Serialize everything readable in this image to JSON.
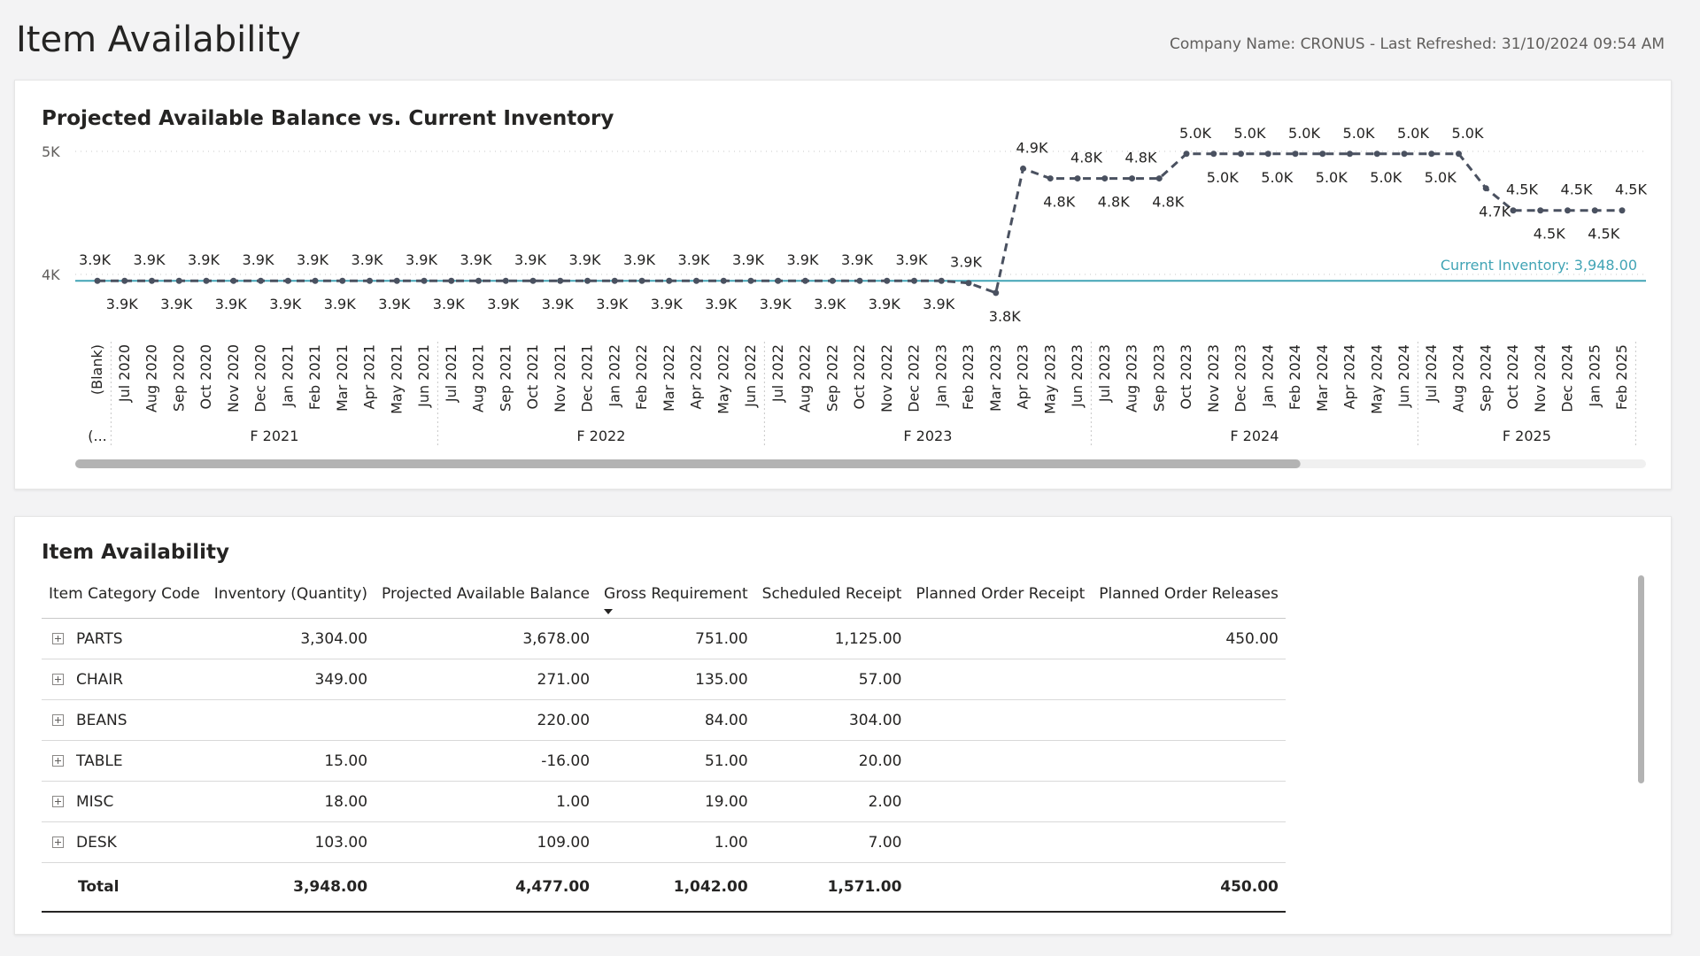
{
  "page": {
    "title": "Item Availability",
    "header_info": "Company Name: CRONUS - Last Refreshed: 31/10/2024 09:54 AM"
  },
  "chart_data": {
    "type": "line",
    "title": "Projected Available Balance vs. Current Inventory",
    "y_ticks": [
      "4K",
      "5K"
    ],
    "ylim": [
      3700,
      5050
    ],
    "categories": [
      "(Blank)",
      "Jul 2020",
      "Aug 2020",
      "Sep 2020",
      "Oct 2020",
      "Nov 2020",
      "Dec 2020",
      "Jan 2021",
      "Feb 2021",
      "Mar 2021",
      "Apr 2021",
      "May 2021",
      "Jun 2021",
      "Jul 2021",
      "Aug 2021",
      "Sep 2021",
      "Oct 2021",
      "Nov 2021",
      "Dec 2021",
      "Jan 2022",
      "Feb 2022",
      "Mar 2022",
      "Apr 2022",
      "May 2022",
      "Jun 2022",
      "Jul 2022",
      "Aug 2022",
      "Sep 2022",
      "Oct 2022",
      "Nov 2022",
      "Dec 2022",
      "Jan 2023",
      "Feb 2023",
      "Mar 2023",
      "Apr 2023",
      "May 2023",
      "Jun 2023",
      "Jul 2023",
      "Aug 2023",
      "Sep 2023",
      "Oct 2023",
      "Nov 2023",
      "Dec 2023",
      "Jan 2024",
      "Feb 2024",
      "Mar 2024",
      "Apr 2024",
      "May 2024",
      "Jun 2024",
      "Jul 2024",
      "Aug 2024",
      "Sep 2024",
      "Oct 2024",
      "Nov 2024",
      "Dec 2024",
      "Jan 2025",
      "Feb 2025"
    ],
    "fiscal_groups": [
      {
        "label": "(...",
        "count": 1
      },
      {
        "label": "F 2021",
        "count": 12
      },
      {
        "label": "F 2022",
        "count": 12
      },
      {
        "label": "F 2023",
        "count": 12
      },
      {
        "label": "F 2024",
        "count": 12
      },
      {
        "label": "F 2025",
        "count": 8
      }
    ],
    "series": [
      {
        "values": [
          3948,
          3948,
          3948,
          3948,
          3948,
          3948,
          3948,
          3948,
          3948,
          3948,
          3948,
          3948,
          3948,
          3948,
          3948,
          3948,
          3948,
          3948,
          3948,
          3948,
          3948,
          3948,
          3948,
          3948,
          3948,
          3948,
          3948,
          3948,
          3948,
          3948,
          3948,
          3948,
          3930,
          3850,
          4860,
          4780,
          4780,
          4780,
          4780,
          4780,
          4980,
          4980,
          4980,
          4980,
          4980,
          4980,
          4980,
          4980,
          4980,
          4980,
          4980,
          4700,
          4520,
          4520,
          4520,
          4520,
          4520
        ],
        "data_labels": [
          "3.9K",
          "3.9K",
          "3.9K",
          "3.9K",
          "3.9K",
          "3.9K",
          "3.9K",
          "3.9K",
          "3.9K",
          "3.9K",
          "3.9K",
          "3.9K",
          "3.9K",
          "3.9K",
          "3.9K",
          "3.9K",
          "3.9K",
          "3.9K",
          "3.9K",
          "3.9K",
          "3.9K",
          "3.9K",
          "3.9K",
          "3.9K",
          "3.9K",
          "3.9K",
          "3.9K",
          "3.9K",
          "3.9K",
          "3.9K",
          "3.9K",
          "3.9K",
          "3.9K",
          "3.8K",
          "4.9K",
          "4.8K",
          "4.8K",
          "4.8K",
          "4.8K",
          "4.8K",
          "5.0K",
          "5.0K",
          "5.0K",
          "5.0K",
          "5.0K",
          "5.0K",
          "5.0K",
          "5.0K",
          "5.0K",
          "5.0K",
          "5.0K",
          "4.7K",
          "4.5K",
          "4.5K",
          "4.5K",
          "4.5K",
          "4.5K"
        ],
        "color": "#4a5160",
        "style": "dashed"
      }
    ],
    "reference_line": {
      "label": "Current Inventory: 3,948.00",
      "value": 3948,
      "color": "#41a4b5"
    },
    "scroll_fraction_visible": 0.78
  },
  "table": {
    "title": "Item Availability",
    "columns": [
      "Item Category Code",
      "Inventory (Quantity)",
      "Projected Available Balance",
      "Gross Requirement",
      "Scheduled Receipt",
      "Planned Order Receipt",
      "Planned Order Releases"
    ],
    "sorted_column": "Gross Requirement",
    "rows": [
      [
        "PARTS",
        "3,304.00",
        "3,678.00",
        "751.00",
        "1,125.00",
        "",
        "450.00"
      ],
      [
        "CHAIR",
        "349.00",
        "271.00",
        "135.00",
        "57.00",
        "",
        ""
      ],
      [
        "BEANS",
        "",
        "220.00",
        "84.00",
        "304.00",
        "",
        ""
      ],
      [
        "TABLE",
        "15.00",
        "-16.00",
        "51.00",
        "20.00",
        "",
        ""
      ],
      [
        "MISC",
        "18.00",
        "1.00",
        "19.00",
        "2.00",
        "",
        ""
      ],
      [
        "DESK",
        "103.00",
        "109.00",
        "1.00",
        "7.00",
        "",
        ""
      ]
    ],
    "total": [
      "Total",
      "3,948.00",
      "4,477.00",
      "1,042.00",
      "1,571.00",
      "",
      "450.00"
    ]
  }
}
